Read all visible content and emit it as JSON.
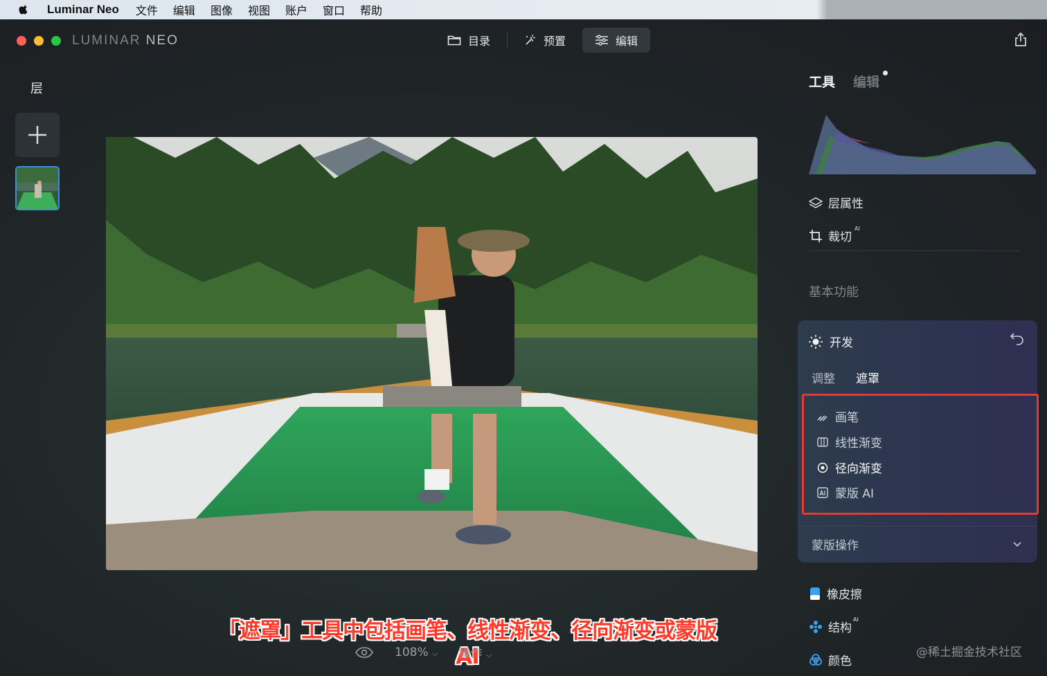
{
  "menubar": {
    "app_name": "Luminar Neo",
    "items": [
      "文件",
      "编辑",
      "图像",
      "视图",
      "账户",
      "窗口",
      "帮助"
    ]
  },
  "window": {
    "logo_left": "LUMINAR",
    "logo_right": "NEO",
    "nav": [
      {
        "label": "目录",
        "icon": "folder-icon"
      },
      {
        "label": "预置",
        "icon": "sparkle-icon"
      },
      {
        "label": "编辑",
        "icon": "sliders-icon",
        "active": true
      }
    ]
  },
  "left_panel": {
    "title": "层"
  },
  "bottom": {
    "zoom": "108%",
    "actions": "操作",
    "caption": "「遮罩」工具中包括画笔、线性渐变、径向渐变或蒙版AI",
    "watermark": "@稀土掘金技术社区"
  },
  "right_panel": {
    "tabs": {
      "tools": "工具",
      "edits": "编辑"
    },
    "layer_properties": "层属性",
    "crop": "裁切",
    "crop_badge": "AI",
    "section_basic": "基本功能",
    "develop": {
      "title": "开发",
      "subtabs": {
        "adjust": "调整",
        "mask": "遮罩"
      },
      "mask_items": [
        {
          "label": "画笔",
          "icon": "brush-icon"
        },
        {
          "label": "线性渐变",
          "icon": "linear-gradient-icon"
        },
        {
          "label": "径向渐变",
          "icon": "radial-gradient-icon",
          "selected": true
        },
        {
          "label": "蒙版 AI",
          "icon": "mask-ai-icon"
        }
      ],
      "mask_operations": "蒙版操作"
    },
    "tools": [
      {
        "label": "橡皮擦",
        "icon": "eraser-icon",
        "badge": ""
      },
      {
        "label": "结构",
        "icon": "structure-icon",
        "badge": "AI"
      },
      {
        "label": "颜色",
        "icon": "color-icon",
        "badge": ""
      }
    ]
  },
  "colors": {
    "accent_blue": "#3e8bdc",
    "highlight_red": "#e23a34",
    "caption_red": "#ff3a2a"
  }
}
